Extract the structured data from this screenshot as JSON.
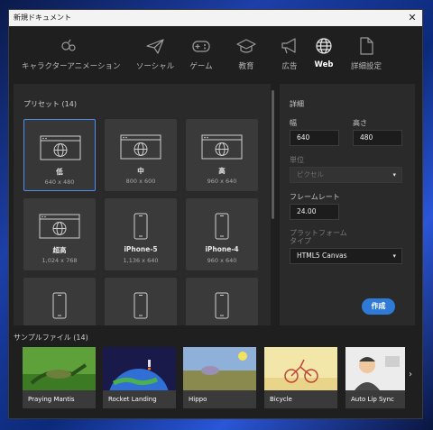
{
  "window": {
    "title": "新規ドキュメント",
    "close_glyph": "✕"
  },
  "tabs": [
    {
      "label": "キャラクターアニメーション",
      "icon": "character-icon"
    },
    {
      "label": "ソーシャル",
      "icon": "paper-plane-icon"
    },
    {
      "label": "ゲーム",
      "icon": "gamepad-icon"
    },
    {
      "label": "教育",
      "icon": "graduation-cap-icon"
    },
    {
      "label": "広告",
      "icon": "megaphone-icon"
    },
    {
      "label": "Web",
      "icon": "globe-icon",
      "active": true
    },
    {
      "label": "詳細設定",
      "icon": "document-icon"
    }
  ],
  "presets": {
    "title": "プリセット (14)",
    "items": [
      {
        "name": "低",
        "dims": "640 x 480",
        "icon": "browser-globe-icon",
        "selected": true
      },
      {
        "name": "中",
        "dims": "800 x 600",
        "icon": "browser-globe-icon"
      },
      {
        "name": "高",
        "dims": "960 x 640",
        "icon": "browser-globe-icon"
      },
      {
        "name": "超高",
        "dims": "1,024 x 768",
        "icon": "browser-globe-icon"
      },
      {
        "name": "iPhone-5",
        "dims": "1,136 x 640",
        "icon": "phone-icon"
      },
      {
        "name": "iPhone-4",
        "dims": "960 x 640",
        "icon": "phone-icon"
      },
      {
        "name": "",
        "dims": "",
        "icon": "phone-icon"
      },
      {
        "name": "",
        "dims": "",
        "icon": "phone-icon"
      },
      {
        "name": "",
        "dims": "",
        "icon": "phone-icon"
      }
    ]
  },
  "details": {
    "title": "詳細",
    "width_label": "幅",
    "width_value": "640",
    "height_label": "高さ",
    "height_value": "480",
    "unit_label": "単位",
    "unit_value": "ピクセル",
    "framerate_label": "フレームレート",
    "framerate_value": "24.00",
    "platform_label": "プラットフォームタイプ",
    "platform_value": "HTML5 Canvas",
    "create_label": "作成"
  },
  "samples": {
    "title": "サンプルファイル (14)",
    "items": [
      {
        "name": "Praying Mantis"
      },
      {
        "name": "Rocket Landing"
      },
      {
        "name": "Hippo"
      },
      {
        "name": "Bicycle"
      },
      {
        "name": "Auto Lip Sync"
      }
    ],
    "next_glyph": "›"
  },
  "colors": {
    "accent": "#2f7ad6",
    "selected_border": "#4a8ef2"
  }
}
